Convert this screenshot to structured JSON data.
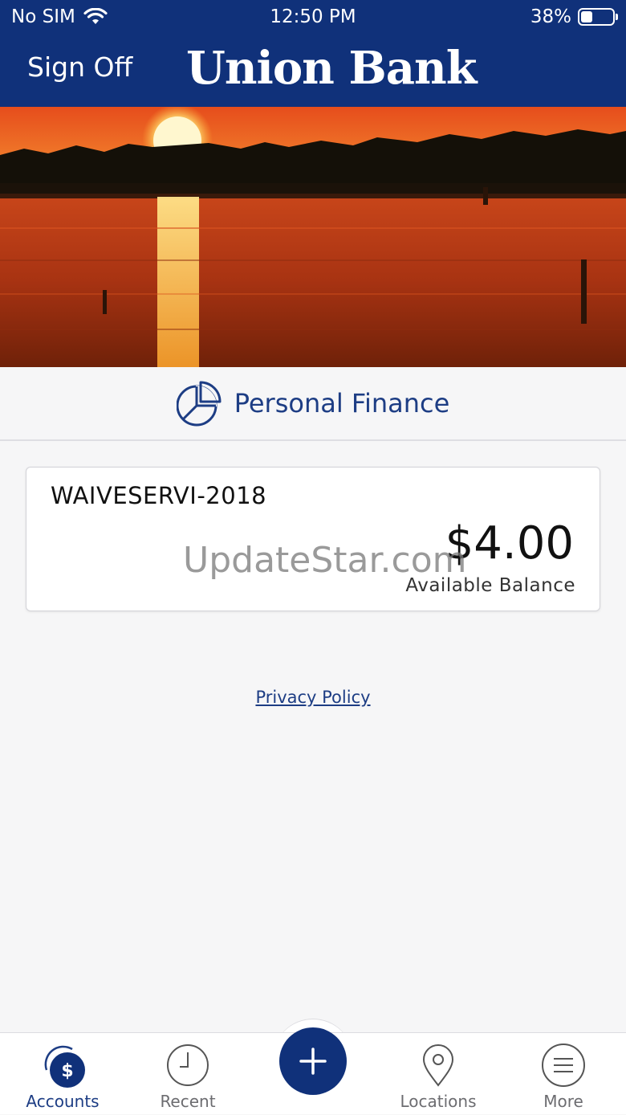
{
  "status_bar": {
    "carrier": "No SIM",
    "time": "12:50 PM",
    "battery_percent": "38%",
    "battery_level": 0.38
  },
  "header": {
    "sign_off_label": "Sign Off",
    "brand": "Union Bank"
  },
  "personal_finance": {
    "label": "Personal Finance",
    "icon": "pie-chart-icon"
  },
  "accounts": [
    {
      "name": "WAIVESERVI-2018",
      "balance": "$4.00",
      "balance_label": "Available Balance"
    }
  ],
  "watermark": "UpdateStar.com",
  "privacy_policy_label": "Privacy Policy",
  "tabbar": {
    "tabs": [
      {
        "label": "Accounts",
        "icon": "accounts-dollar-icon",
        "active": true
      },
      {
        "label": "Recent",
        "icon": "clock-icon",
        "active": false
      },
      {
        "label": "",
        "icon": "plus-icon",
        "active": false
      },
      {
        "label": "Locations",
        "icon": "map-pin-icon",
        "active": false
      },
      {
        "label": "More",
        "icon": "menu-icon",
        "active": false
      }
    ]
  },
  "colors": {
    "brand_navy": "#10317a",
    "link_blue": "#1d3d84",
    "background": "#f6f6f7"
  }
}
